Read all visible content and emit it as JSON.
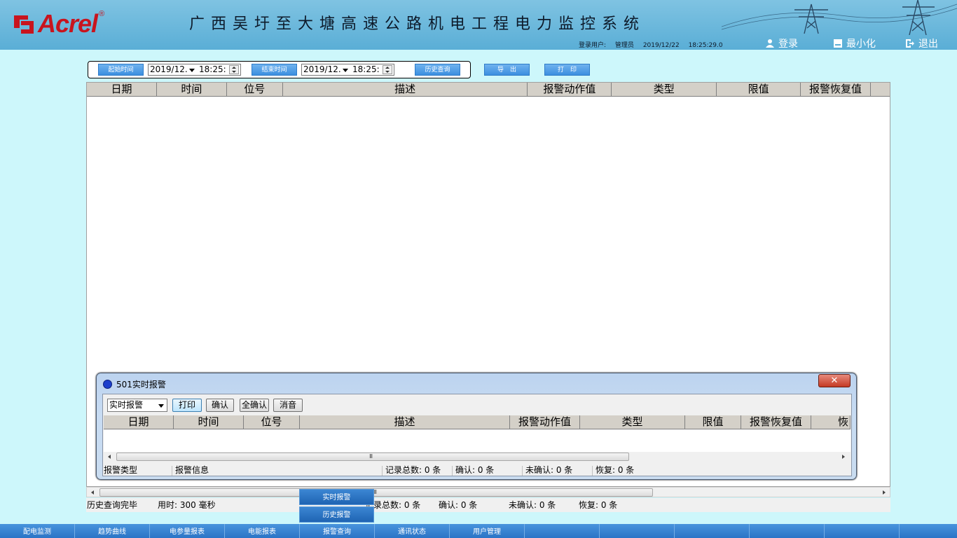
{
  "header": {
    "logo_text": "Acrel",
    "logo_reg": "®",
    "system_title": "广西吴圩至大塘高速公路机电工程电力监控系统",
    "user_label": "登录用户:",
    "user_name": "管理员",
    "date": "2019/12/22",
    "time": "18:25:29.0",
    "login_label": "登录",
    "minimize_label": "最小化",
    "exit_label": "退出"
  },
  "query": {
    "start_label": "起始时间",
    "start_date": "2019/12.",
    "start_time": "18:25:",
    "end_label": "结束时间",
    "end_date": "2019/12.",
    "end_time": "18:25:",
    "history_query_label": "历史查询",
    "export_label": "导　出",
    "print_label": "打　印"
  },
  "main_table": {
    "columns": [
      "日期",
      "时间",
      "位号",
      "描述",
      "报警动作值",
      "类型",
      "限值",
      "报警恢复值"
    ]
  },
  "main_status": {
    "message": "历史查询完毕",
    "elapsed": "用时: 300 毫秒",
    "total": "记录总数: 0 条",
    "confirmed": "确认: 0 条",
    "unconfirmed": "未确认: 0 条",
    "recovered": "恢复: 0 条"
  },
  "popup": {
    "title": "501实时报警",
    "close_label": "✕",
    "select_value": "实时报警",
    "buttons": [
      "打印",
      "确认",
      "全确认",
      "消音"
    ],
    "columns": [
      "日期",
      "时间",
      "位号",
      "描述",
      "报警动作值",
      "类型",
      "限值",
      "报警恢复值",
      "恢"
    ],
    "status": {
      "alarm_type": "报警类型",
      "alarm_info": "报警信息",
      "total": "记录总数: 0 条",
      "confirmed": "确认: 0 条",
      "unconfirmed": "未确认: 0 条",
      "recovered": "恢复: 0 条"
    }
  },
  "submenu": {
    "realtime_alarm": "实时报警",
    "history_alarm": "历史报警"
  },
  "nav": {
    "items": [
      "配电监测",
      "趋势曲线",
      "电参量报表",
      "电能报表",
      "报警查询",
      "通讯状态",
      "用户管理",
      "",
      "",
      "",
      "",
      "",
      ""
    ]
  },
  "colors": {
    "header_bg": "#5aaed6",
    "logo_red": "#c8141e",
    "page_bg": "#cdf7fb",
    "button_blue": "#3c8fe0",
    "nav_blue": "#2b74c6"
  }
}
